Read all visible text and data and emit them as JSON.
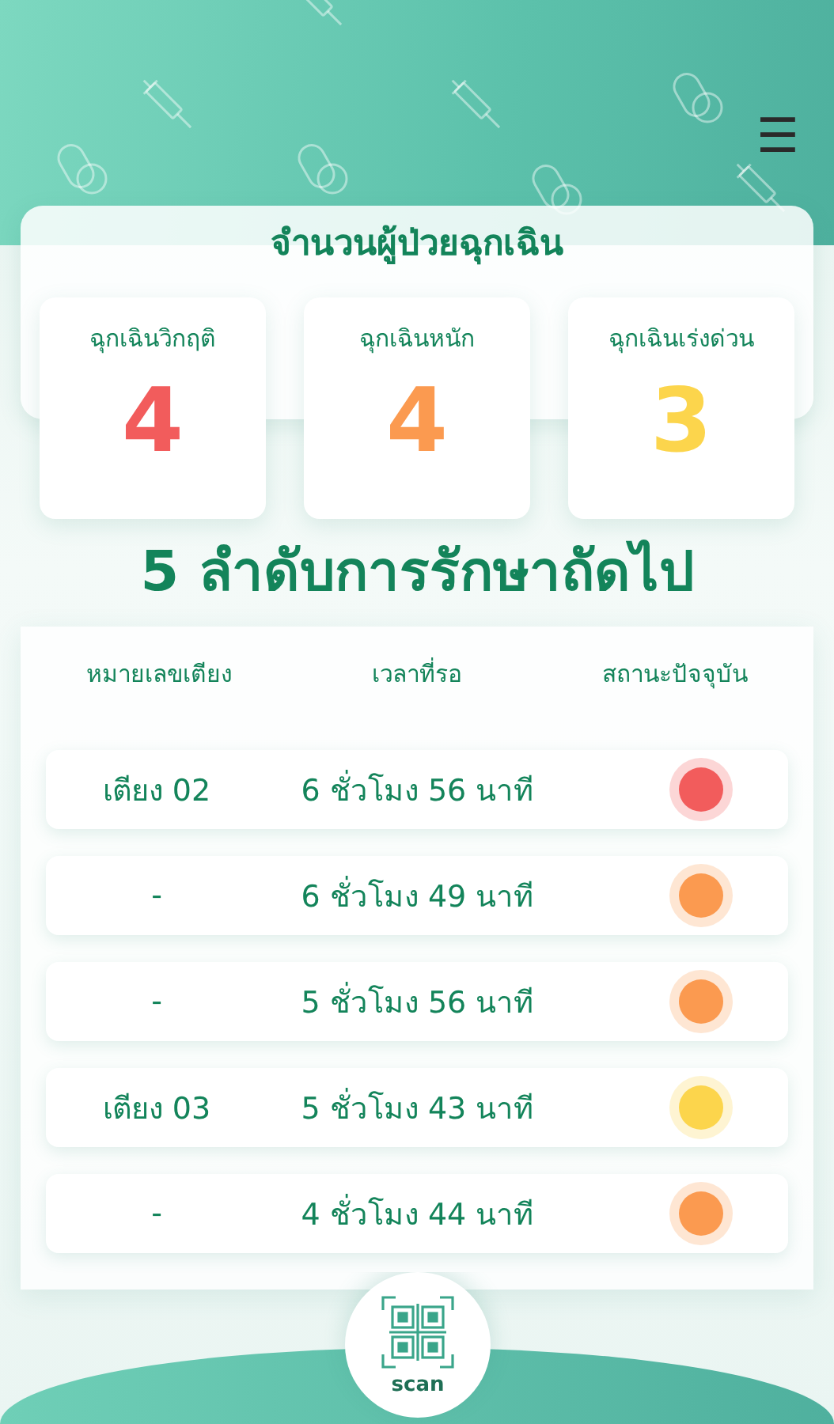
{
  "header": {
    "menu_icon": "☰"
  },
  "summary": {
    "title": "จำนวนผู้ป่วยฉุกเฉิน",
    "cards": [
      {
        "label": "ฉุกเฉินวิกฤติ",
        "count": "4",
        "color": "#f25c5c"
      },
      {
        "label": "ฉุกเฉินหนัก",
        "count": "4",
        "color": "#fb9a50"
      },
      {
        "label": "ฉุกเฉินเร่งด่วน",
        "count": "3",
        "color": "#fcd54c"
      }
    ]
  },
  "queue": {
    "title": "5 ลำดับการรักษาถัดไป",
    "columns": [
      "หมายเลขเตียง",
      "เวลาที่รอ",
      "สถานะปัจจุบัน"
    ],
    "rows": [
      {
        "bed": "เตียง 02",
        "wait": "6 ชั่วโมง 56 นาที",
        "color": "#f25c5c"
      },
      {
        "bed": "-",
        "wait": "6 ชั่วโมง 49 นาที",
        "color": "#fb9a50"
      },
      {
        "bed": "-",
        "wait": "5 ชั่วโมง 56 นาที",
        "color": "#fb9a50"
      },
      {
        "bed": "เตียง 03",
        "wait": "5 ชั่วโมง 43 นาที",
        "color": "#fcd54c"
      },
      {
        "bed": "-",
        "wait": "4 ชั่วโมง 44 นาที",
        "color": "#fb9a50"
      }
    ]
  },
  "scan": {
    "label": "scan"
  }
}
